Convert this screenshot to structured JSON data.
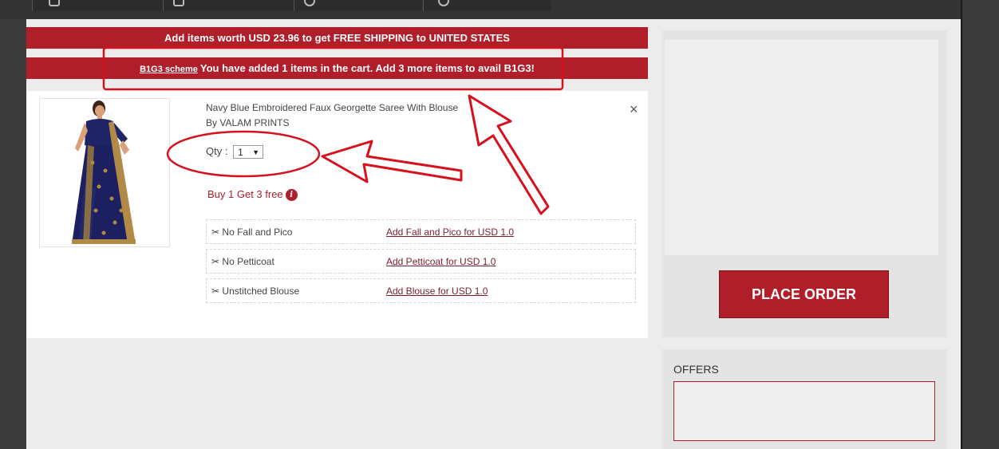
{
  "colors": {
    "accent": "#b01e2a",
    "annotation": "#d6101c",
    "frame": "#3a3a3a"
  },
  "banners": {
    "shipping": "Add items worth USD 23.96 to get FREE SHIPPING to UNITED STATES",
    "scheme_link": "B1G3 scheme",
    "scheme_text": "You have added 1 items in the cart. Add 3 more items to avail B1G3!"
  },
  "cart": {
    "product": {
      "title": "Navy Blue Embroidered Faux Georgette Saree With Blouse",
      "seller": "By VALAM PRINTS",
      "qty_label": "Qty :",
      "qty_value": "1",
      "offer": "Buy 1 Get 3 free",
      "close_symbol": "×"
    },
    "addons": [
      {
        "label": "No Fall and Pico",
        "link": "Add Fall and Pico for USD 1.0"
      },
      {
        "label": "No Petticoat",
        "link": "Add Petticoat for USD 1.0"
      },
      {
        "label": "Unstitched Blouse",
        "link": "Add Blouse for USD 1.0"
      }
    ]
  },
  "sidebar": {
    "place_order": "PLACE ORDER",
    "offers_title": "OFFERS"
  },
  "icons": {
    "scissors": "✂",
    "info": "i",
    "dropdown": "▼"
  }
}
